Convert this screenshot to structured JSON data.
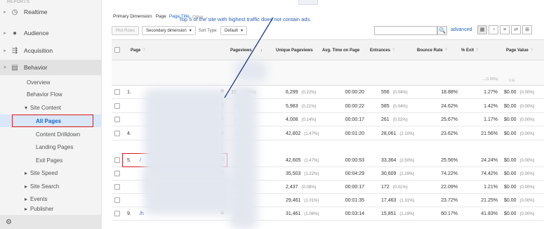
{
  "sidebar": {
    "header": "REPORTS",
    "nav": [
      {
        "label": "Realtime",
        "icon": "clock-icon"
      },
      {
        "label": "Audience",
        "icon": "person-icon"
      },
      {
        "label": "Acquisition",
        "icon": "acquisition-icon"
      },
      {
        "label": "Behavior",
        "icon": "behavior-icon"
      }
    ],
    "behavior_items": [
      "Overview",
      "Behavior Flow"
    ],
    "site_content_label": "Site Content",
    "site_content_items": [
      "All Pages",
      "Content Drilldown",
      "Landing Pages",
      "Exit Pages"
    ],
    "more_items": [
      "Site Speed",
      "Site Search",
      "Events",
      "Publisher"
    ],
    "footer_icon": "gear-icon"
  },
  "toolbar": {
    "collapse_label": "⌃",
    "primary_dimension_label": "Primary Dimension:",
    "primary_dimension_active": "Page",
    "primary_dimension_link": "Page Title",
    "primary_dimension_other": "Other ⌄",
    "plot_rows": "Plot Rows",
    "secondary_dimension": "Secondary dimension",
    "sort_type_label": "Sort Type:",
    "sort_type_value": "Default",
    "search_placeholder": "",
    "advanced": "advanced"
  },
  "annotation": "Top 5 of the site with highest traffic does not contain ads.",
  "table": {
    "headers": [
      "Page",
      "Pageviews",
      "Unique Pageviews",
      "Avg. Time on Page",
      "Entrances",
      "Bounce Rate",
      "% Exit",
      "Page Value"
    ],
    "totals_fragments": [
      "…(1.90%)",
      "U.E."
    ],
    "rows": [
      {
        "num": "1.",
        "page": "",
        "pageviews": "10,",
        "pv_pct": "(2.65%)",
        "unique": "6,299",
        "u_pct": "(0.22%)",
        "time": "00:00:20",
        "entrances": "556",
        "e_pct": "(0.04%)",
        "bounce": "18.88%",
        "exit": "1.27%",
        "value": "$0.00",
        "v_pct": "(0.00%)"
      },
      {
        "num": "",
        "page": "",
        "pageviews": "",
        "pv_pct": "(2.58%)",
        "unique": "5,983",
        "u_pct": "(0.21%)",
        "time": "00:00:22",
        "entrances": "585",
        "e_pct": "(0.04%)",
        "bounce": "24.62%",
        "exit": "1.42%",
        "value": "$0.00",
        "v_pct": "(0.00%)"
      },
      {
        "num": "",
        "page": "",
        "pageviews": "",
        "pv_pct": "1.59%)",
        "unique": "4,008",
        "u_pct": "(0.14%)",
        "time": "00:00:17",
        "entrances": "261",
        "e_pct": "(0.02%)",
        "bounce": "25.67%",
        "exit": "1.17%",
        "value": "$0.00",
        "v_pct": "(0.00%)"
      },
      {
        "num": "4.",
        "page": "",
        "pageviews": "",
        "pv_pct": ".49%)",
        "unique": "42,802",
        "u_pct": "(1.47%)",
        "time": "00:01:20",
        "entrances": "28,061",
        "e_pct": "(2.10%)",
        "bounce": "23.62%",
        "exit": "21.56%",
        "value": "$0.00",
        "v_pct": "(0.00%)"
      },
      {
        "num": "5.",
        "page": "/",
        "pageviews": "",
        "pv_pct": ".34%)",
        "unique": "42,605",
        "u_pct": "(1.47%)",
        "time": "00:00:53",
        "entrances": "33,364",
        "e_pct": "(2.50%)",
        "bounce": "25.56%",
        "exit": "24.24%",
        "value": "$0.00",
        "v_pct": "(0.00%)"
      },
      {
        "num": "",
        "page": "",
        "pageviews": "",
        "pv_pct": ".02%)",
        "unique": "35,503",
        "u_pct": "(1.22%)",
        "time": "00:04:29",
        "entrances": "30,609",
        "e_pct": "(2.29%)",
        "bounce": "74.22%",
        "exit": "74.42%",
        "value": "$0.00",
        "v_pct": "(0.00%)"
      },
      {
        "num": "",
        "page": "",
        "pageviews": "",
        "pv_pct": "0.96%)",
        "unique": "2,437",
        "u_pct": "(0.08%)",
        "time": "00:00:17",
        "entrances": "172",
        "e_pct": "(0.01%)",
        "bounce": "22.09%",
        "exit": "1.21%",
        "value": "$0.00",
        "v_pct": "(0.00%)"
      },
      {
        "num": "",
        "page": "",
        "pageviews": "",
        "pv_pct": "95%)",
        "unique": "29,461",
        "u_pct": "(1.01%)",
        "time": "00:01:35",
        "entrances": "17,463",
        "e_pct": "(1.31%)",
        "bounce": "23.72%",
        "exit": "21.25%",
        "value": "$0.00",
        "v_pct": "(0.00%)"
      },
      {
        "num": "9.",
        "page": "/h",
        "pageviews": "",
        "pv_pct": ".85%)",
        "unique": "31,461",
        "u_pct": "(1.08%)",
        "time": "00:03:14",
        "entrances": "15,851",
        "e_pct": "(1.19%)",
        "bounce": "60.17%",
        "exit": "41.83%",
        "value": "$0.00",
        "v_pct": "(0.00%)"
      }
    ]
  },
  "colors": {
    "highlight": "#d71920",
    "link": "#1a66c7",
    "annotation": "#2a5fb0"
  }
}
